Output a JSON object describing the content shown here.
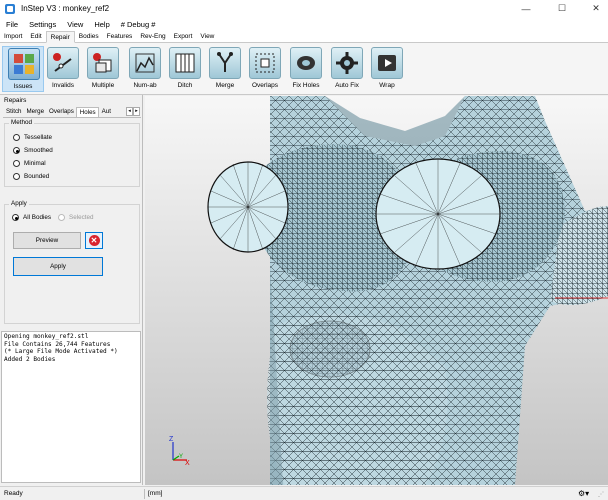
{
  "window": {
    "title": "InStep V3 : monkey_ref2",
    "min_icon": "minimize-icon",
    "max_icon": "maximize-icon",
    "close_icon": "close-icon",
    "min_glyph": "—",
    "max_glyph": "☐",
    "close_glyph": "✕"
  },
  "menu": [
    "File",
    "Settings",
    "View",
    "Help",
    "# Debug #"
  ],
  "ribbon_tabs": [
    "Import",
    "Edit",
    "Repair",
    "Bodies",
    "Features",
    "Rev-Eng",
    "Export",
    "View"
  ],
  "active_ribbon_tab": "Repair",
  "toolbar": [
    {
      "label": "Issues",
      "icon": "issues-icon",
      "active": true
    },
    {
      "label": "Invalids",
      "icon": "invalids-icon"
    },
    {
      "label": "Multiple",
      "icon": "multiple-icon"
    },
    {
      "label": "Num-ab",
      "icon": "num-ab-icon"
    },
    {
      "label": "Ditch",
      "icon": "ditch-icon"
    },
    {
      "label": "Merge",
      "icon": "merge-icon"
    },
    {
      "label": "Overlaps",
      "icon": "overlaps-icon"
    },
    {
      "label": "Fix Holes",
      "icon": "fix-holes-icon"
    },
    {
      "label": "Auto Fix",
      "icon": "auto-fix-icon"
    },
    {
      "label": "Wrap",
      "icon": "wrap-icon"
    }
  ],
  "panel": {
    "title": "Repairs",
    "subtabs": [
      "Stitch",
      "Merge",
      "Overlaps",
      "Holes",
      "Aut"
    ],
    "active_subtab": "Holes",
    "method": {
      "title": "Method",
      "options": [
        "Tessellate",
        "Smoothed",
        "Minimal",
        "Bounded"
      ],
      "selected": "Smoothed"
    },
    "apply": {
      "title": "Apply",
      "options": [
        "All Bodies",
        "Selected"
      ],
      "selected": "All Bodies"
    },
    "preview_label": "Preview",
    "apply_label": "Apply",
    "cancel_icon": "cancel-icon",
    "cancel_glyph": "✕",
    "left_glyph": "◂",
    "right_glyph": "▸"
  },
  "log": [
    "Opening monkey_ref2.stl",
    "File Contains 26,744 Features",
    "(* Large File Mode Activated *)",
    "Added 2 Bodies"
  ],
  "viewport": {
    "axis_z": "Z",
    "axis_y": "Y",
    "axis_x": "X"
  },
  "status": {
    "ready": "Ready",
    "units": "[mm]",
    "icon": "settings-icon",
    "icon_glyph": "⚙▾",
    "grip": "⋰"
  }
}
